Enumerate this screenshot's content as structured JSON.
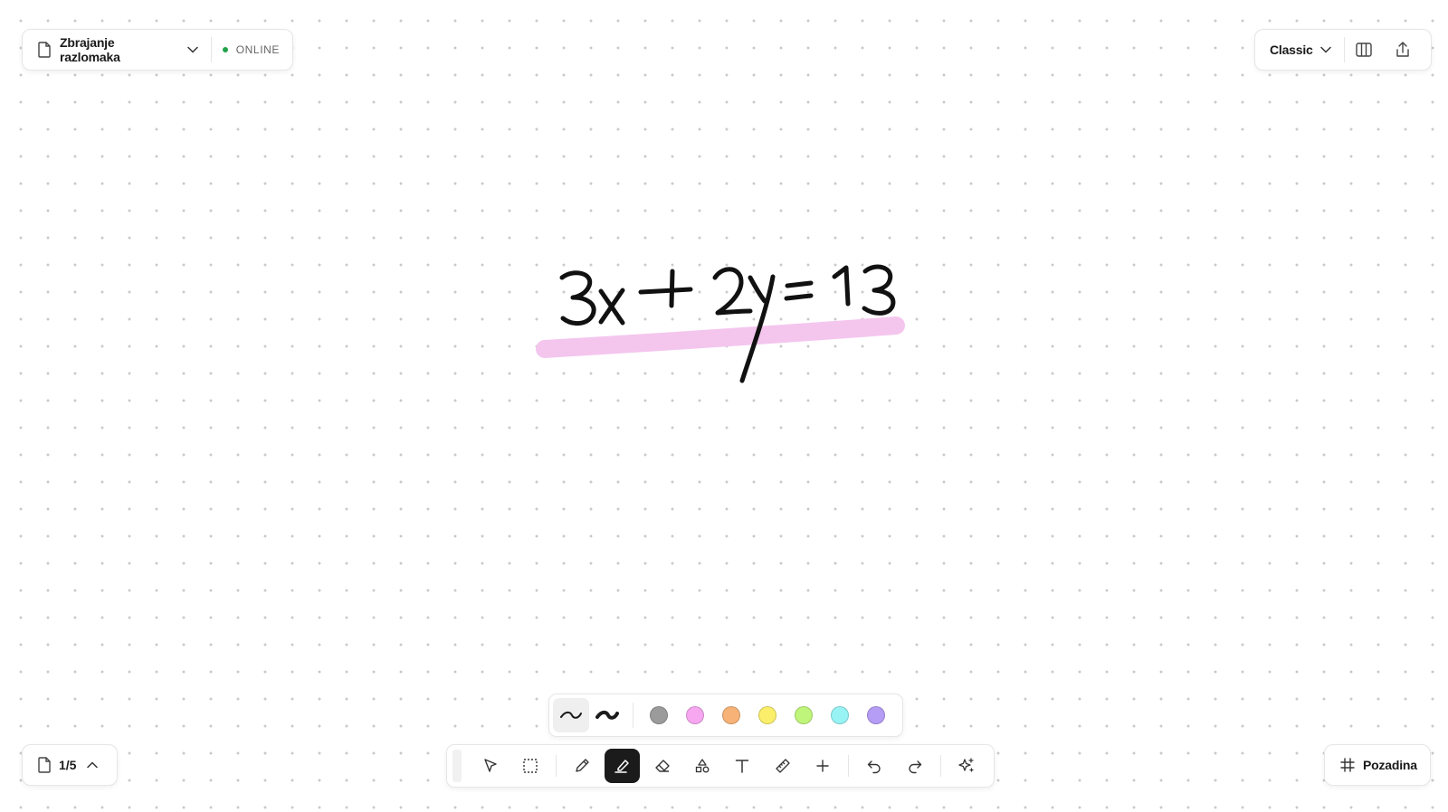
{
  "document": {
    "title": "Zbrajanje razlomaka",
    "status": "ONLINE",
    "status_color": "#22a34a"
  },
  "view": {
    "mode": "Classic"
  },
  "pages": {
    "indicator": "1/5"
  },
  "background_button": {
    "label": "Pozadina"
  },
  "style_bar": {
    "strokes": [
      {
        "name": "thin-stroke",
        "active": true
      },
      {
        "name": "thick-stroke",
        "active": false
      }
    ],
    "colors": [
      {
        "name": "gray",
        "hex": "#9b9b9b"
      },
      {
        "name": "pink",
        "hex": "#f7a6f0"
      },
      {
        "name": "orange",
        "hex": "#f6b277"
      },
      {
        "name": "yellow",
        "hex": "#fbee6a"
      },
      {
        "name": "green",
        "hex": "#bff57a"
      },
      {
        "name": "cyan",
        "hex": "#97f3f4"
      },
      {
        "name": "purple",
        "hex": "#b59cf5"
      }
    ]
  },
  "toolbar": {
    "tools": [
      "select-tool",
      "marquee-tool",
      "pen-tool",
      "highlighter-tool",
      "eraser-tool",
      "shapes-tool",
      "text-tool",
      "ruler-tool",
      "add-tool",
      "undo",
      "redo",
      "ai-sparkle"
    ],
    "active_tool": "highlighter-tool"
  },
  "canvas": {
    "handwriting": "3x + 2y = 13",
    "highlight_color": "#f4c6ee"
  }
}
